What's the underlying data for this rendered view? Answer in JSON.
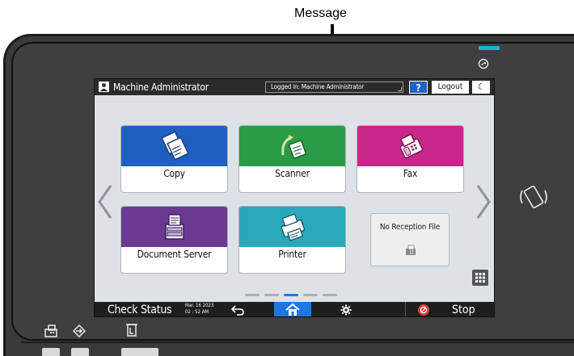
{
  "callout": {
    "label": "Message"
  },
  "topbar": {
    "user": "Machine Administrator",
    "message": "Logged in: Machine Administrator",
    "help": "?",
    "logout": "Logout",
    "energy": "☾"
  },
  "apps": [
    {
      "label": "Copy"
    },
    {
      "label": "Scanner"
    },
    {
      "label": "Fax"
    },
    {
      "label": "Document Server"
    },
    {
      "label": "Printer"
    }
  ],
  "widget": {
    "title": "No Reception File"
  },
  "bottombar": {
    "check_status": "Check Status",
    "date": "Mar. 16 2023",
    "time": "02 : 52 AM",
    "stop": "Stop"
  },
  "pager": {
    "pages": 5,
    "current": 3
  },
  "colors": {
    "copy": "#1f5fbf",
    "scanner": "#2c9b45",
    "fax": "#c8268d",
    "document_server": "#6a3a93",
    "printer": "#2aa7b9",
    "home_active": "#1f78e0",
    "led": "#1fb3d6"
  },
  "icons": [
    "user-icon",
    "help-icon",
    "moon-icon",
    "copy-icon",
    "scanner-icon",
    "fax-icon",
    "document-server-icon",
    "printer-icon",
    "fax-tray-icon",
    "grid-icon",
    "back-icon",
    "home-icon",
    "gear-icon",
    "stop-icon",
    "power-icon",
    "nfc-icon"
  ]
}
